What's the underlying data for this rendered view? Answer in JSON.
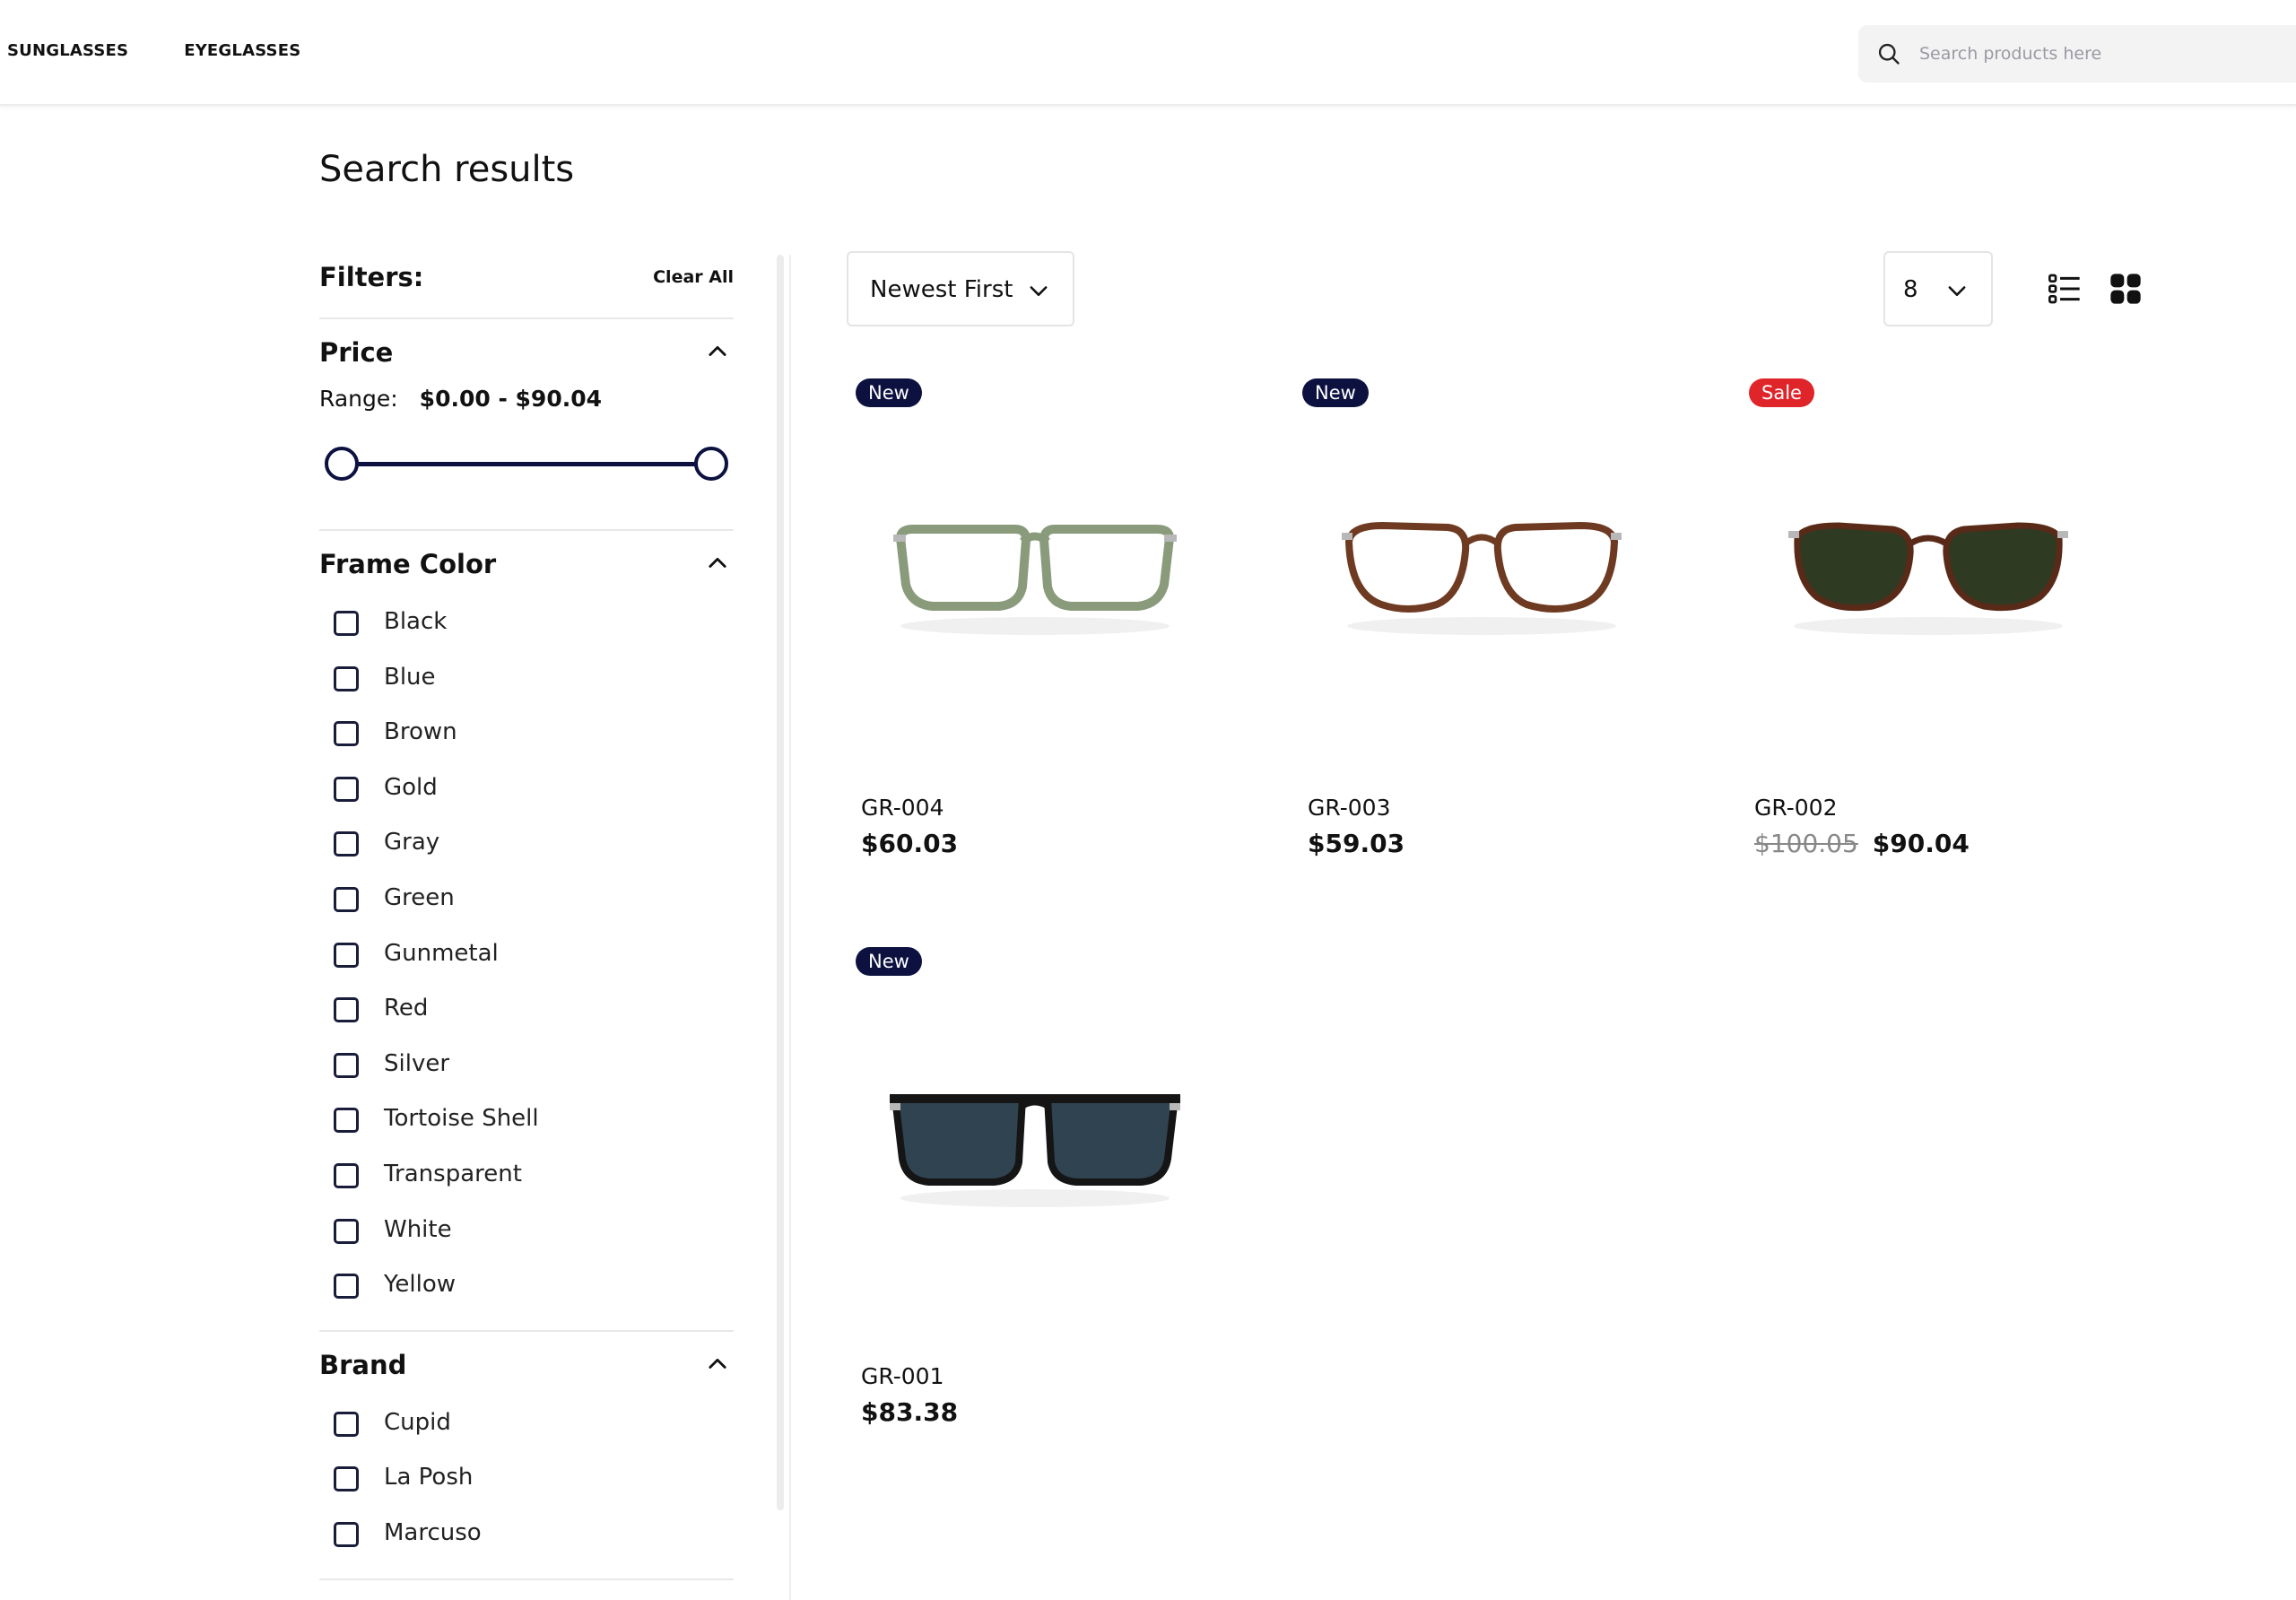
{
  "header": {
    "nav": [
      {
        "label": "SUNGLASSES"
      },
      {
        "label": "EYEGLASSES"
      }
    ],
    "search": {
      "placeholder": "Search products here",
      "icon": "search-icon"
    }
  },
  "page": {
    "title": "Search results"
  },
  "filters": {
    "title": "Filters:",
    "clear_all": "Clear All",
    "price": {
      "title": "Price",
      "range_label": "Range:",
      "range_value": "$0.00 - $90.04",
      "min": 0.0,
      "max": 90.04
    },
    "frame_color": {
      "title": "Frame Color",
      "options": [
        "Black",
        "Blue",
        "Brown",
        "Gold",
        "Gray",
        "Green",
        "Gunmetal",
        "Red",
        "Silver",
        "Tortoise Shell",
        "Transparent",
        "White",
        "Yellow"
      ]
    },
    "brand": {
      "title": "Brand",
      "options": [
        "Cupid",
        "La Posh",
        "Marcuso"
      ]
    }
  },
  "toolbar": {
    "sort": {
      "selected": "Newest First"
    },
    "per_page": {
      "selected": "8"
    },
    "views": [
      "list-view",
      "grid-view"
    ]
  },
  "products": [
    {
      "badge": "New",
      "badge_type": "new",
      "name": "GR-004",
      "price": "$60.03",
      "old_price": "",
      "frame_color": "#8a9b7c",
      "lens_color": "none"
    },
    {
      "badge": "New",
      "badge_type": "new",
      "name": "GR-003",
      "price": "$59.03",
      "old_price": "",
      "frame_color": "#6e3a22",
      "lens_color": "none"
    },
    {
      "badge": "Sale",
      "badge_type": "sale",
      "name": "GR-002",
      "price": "$90.04",
      "old_price": "$100.05",
      "frame_color": "#5a2a18",
      "lens_color": "#2e3a22"
    },
    {
      "badge": "New",
      "badge_type": "new",
      "name": "GR-001",
      "price": "$83.38",
      "old_price": "",
      "frame_color": "#151515",
      "lens_color": "#2f4350"
    }
  ],
  "colors": {
    "accent": "#0c1140",
    "sale": "#e0252a"
  }
}
